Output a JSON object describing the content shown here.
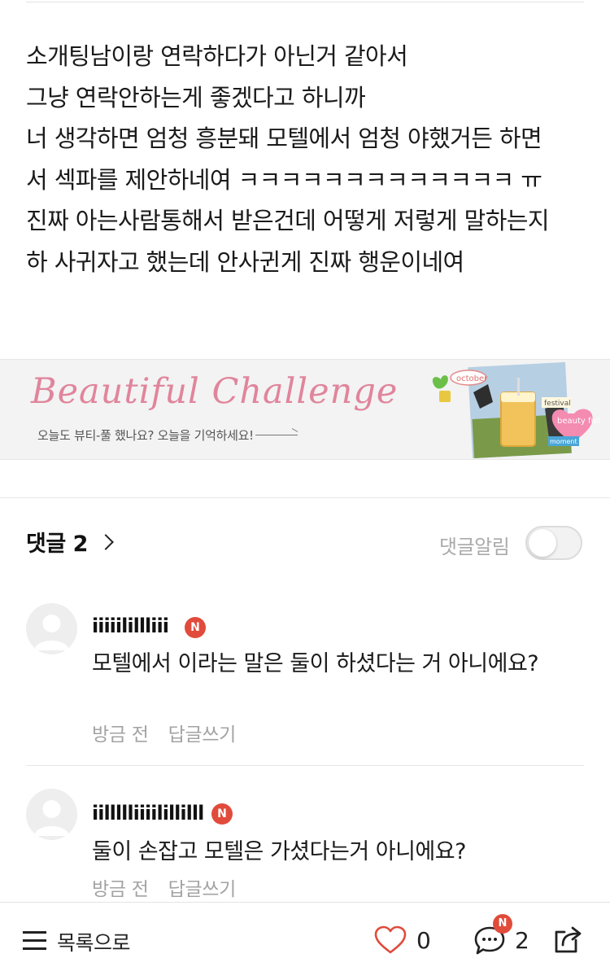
{
  "post": {
    "lines": [
      "소개팅남이랑 연락하다가 아닌거 같아서",
      "그냥 연락안하는게 좋겠다고 하니까",
      "너 생각하면 엄청 흥분돼 모텔에서 엄청 야했거든 하면",
      "서 섹파를 제안하네여 ㅋㅋㅋㅋㅋㅋㅋㅋㅋㅋㅋㅋㅋ ㅠ",
      "진짜 아는사람통해서 받은건데 어떻게 저렇게 말하는지",
      "하 사귀자고 했는데 안사귄게 진짜 행운이네여"
    ]
  },
  "banner": {
    "title": "Beautiful Challenge",
    "subtitle": "오늘도 뷰티-풀 했나요? 오늘을 기억하세요!",
    "tags": [
      "october",
      "festival",
      "beauty full",
      "moment"
    ],
    "accent_color": "#e0859c"
  },
  "comments_section": {
    "header_label": "댓글",
    "count": "2",
    "notify_label": "댓글알림",
    "notify_on": false
  },
  "comments": [
    {
      "author": "iiiiilillliii",
      "badge": "N",
      "text": "모텔에서 이라는 말은 둘이 하셨다는 거 아니에요?",
      "time": "방금 전",
      "reply_label": "답글쓰기"
    },
    {
      "author": "iillllliiiilillilll",
      "badge": "N",
      "text": "둘이 손잡고 모텔은 가셨다는거 아니에요?",
      "time": "방금 전",
      "reply_label": "답글쓰기"
    }
  ],
  "bottom_bar": {
    "list_label": "목록으로",
    "like_count": "0",
    "comment_count": "2",
    "comment_badge": "N",
    "badge_color": "#e14b3b",
    "icons": [
      "menu-icon",
      "heart-icon",
      "comment-icon",
      "share-icon"
    ]
  }
}
